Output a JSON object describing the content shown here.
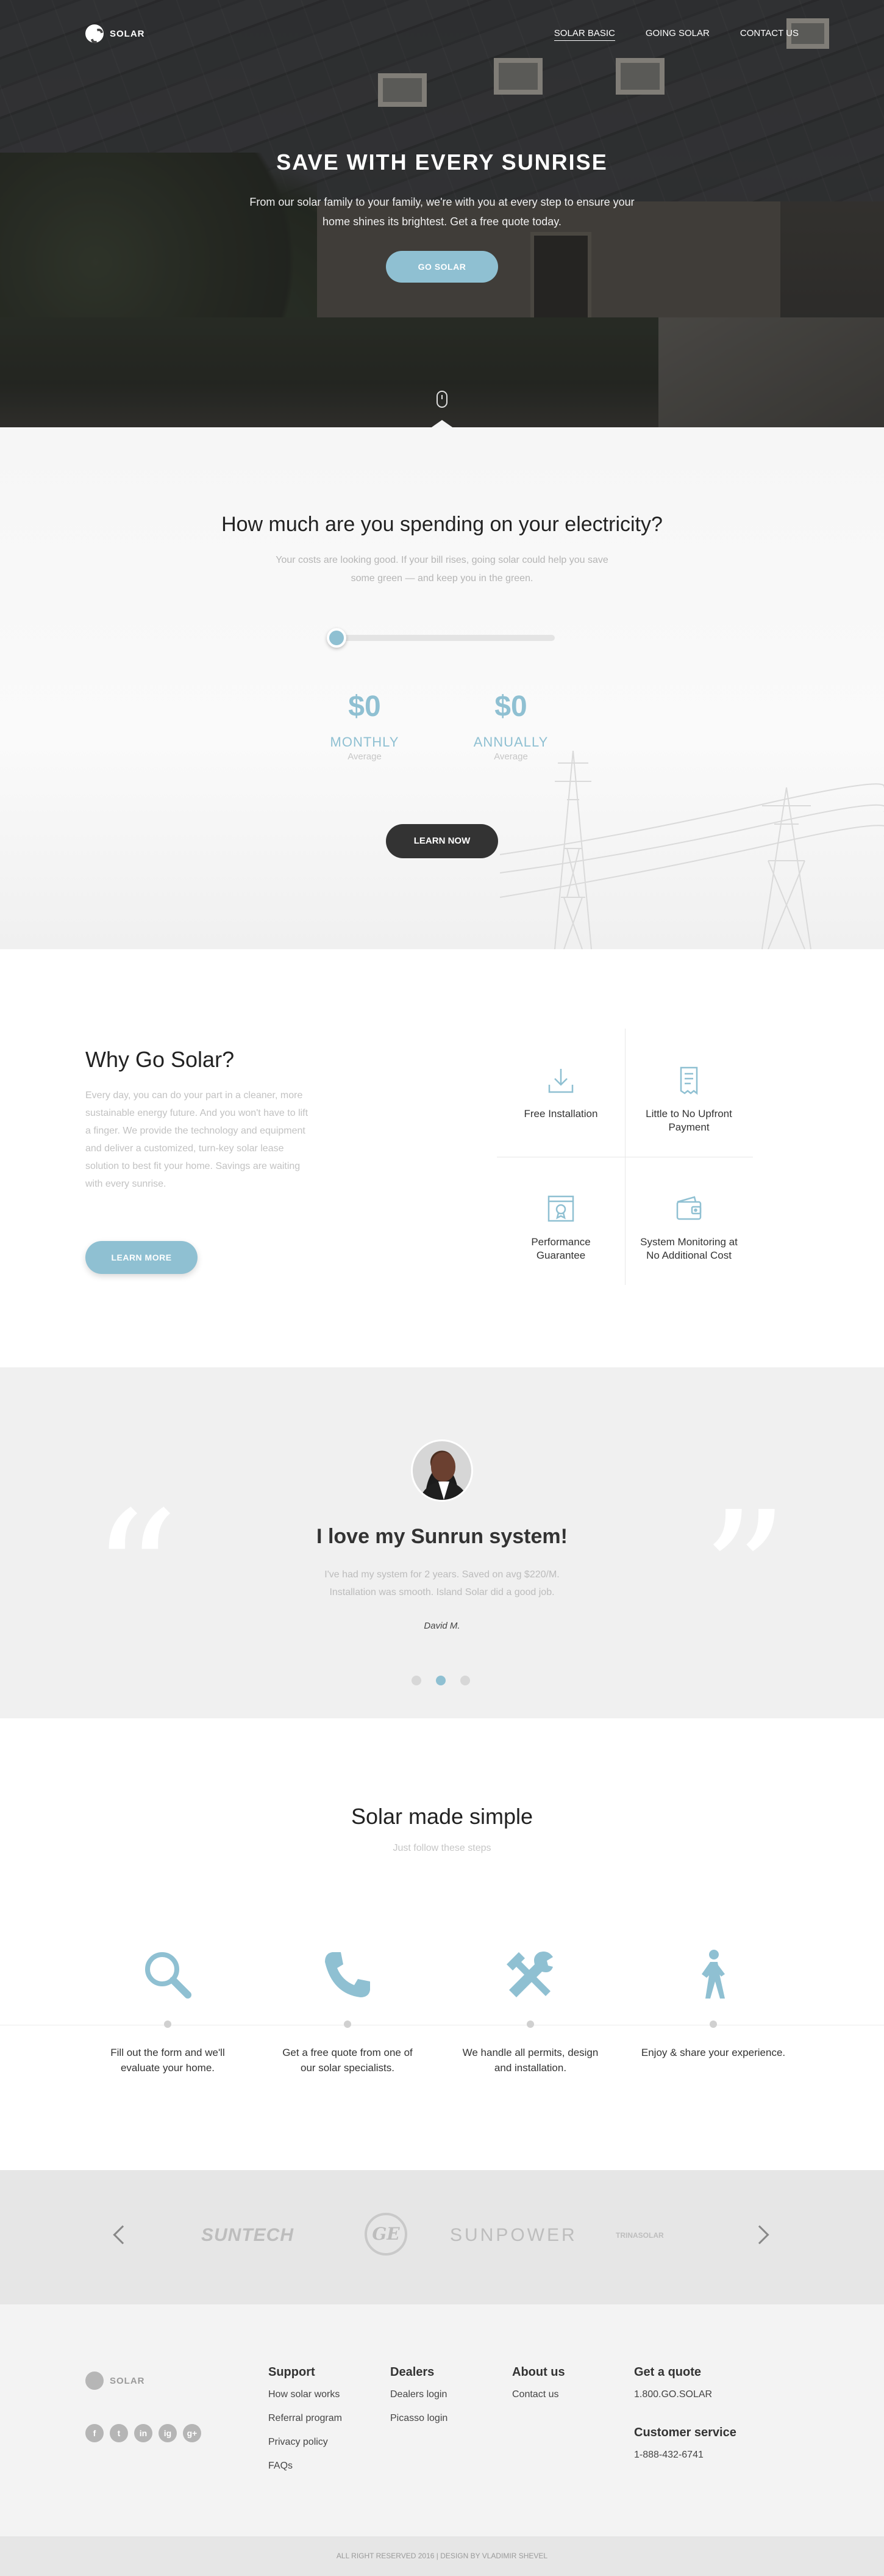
{
  "brand": {
    "name": "SOLAR"
  },
  "nav": {
    "items": [
      "SOLAR BASIC",
      "GOING SOLAR",
      "CONTACT US"
    ]
  },
  "hero": {
    "title": "SAVE WITH EVERY SUNRISE",
    "subtitle": "From our solar family to your family, we're with you at every step to ensure your home shines its brightest. Get a free quote today.",
    "cta": "GO SOLAR"
  },
  "spend": {
    "title": "How much are you spending on your electricity?",
    "subtitle": "Your costs are looking good. If your bill rises, going solar could help you save some green — and keep you in the green.",
    "slider_value": 0,
    "monthly": {
      "value": "$0",
      "label": "MONTHLY",
      "note": "Average"
    },
    "annually": {
      "value": "$0",
      "label": "ANNUALLY",
      "note": "Average"
    },
    "cta": "LEARN NOW"
  },
  "why": {
    "title": "Why Go Solar?",
    "body": "Every day, you can do your part in a cleaner, more sustainable energy future. And you won't have to lift a finger. We provide the technology and equipment and deliver a customized, turn-key solar lease solution to best fit your home. Savings are waiting with every sunrise.",
    "cta": "LEARN MORE",
    "features": [
      {
        "label": "Free Installation",
        "icon": "download-icon"
      },
      {
        "label": "Little to No Upfront Payment",
        "icon": "receipt-icon"
      },
      {
        "label": "Performance Guarantee",
        "icon": "certificate-icon"
      },
      {
        "label": "System Monitoring at No Additional Cost",
        "icon": "wallet-icon"
      }
    ]
  },
  "testimonial": {
    "title": "I love my Sunrun system!",
    "body": "I've had my system for 2 years. Saved on avg $220/M. Installation was smooth. Island Solar did a good job.",
    "author": "David M.",
    "active_dot": 1
  },
  "simple": {
    "title": "Solar made simple",
    "subtitle": "Just follow these steps",
    "steps": [
      {
        "label": "Fill out the form and we'll evaluate your home.",
        "icon": "magnifier-icon"
      },
      {
        "label": "Get a free quote from one of our solar specialists.",
        "icon": "phone-icon"
      },
      {
        "label": "We handle all permits, design and installation.",
        "icon": "tools-icon"
      },
      {
        "label": "Enjoy & share your experience.",
        "icon": "walking-person-icon"
      }
    ]
  },
  "partners": [
    "SUNTECH",
    "GE",
    "SUNPOWER",
    "TRINASOLAR"
  ],
  "footer": {
    "brand": "SOLAR",
    "social": [
      "f",
      "t",
      "in",
      "ig",
      "g+"
    ],
    "support": {
      "title": "Support",
      "links": [
        "How solar works",
        "Referral program",
        "Privacy policy",
        "FAQs"
      ]
    },
    "dealers": {
      "title": "Dealers",
      "links": [
        "Dealers login",
        "Picasso login"
      ]
    },
    "about": {
      "title": "About us",
      "links": [
        "Contact us"
      ]
    },
    "quote": {
      "title": "Get a quote",
      "phone": "1.800.GO.SOLAR"
    },
    "service": {
      "title": "Customer service",
      "phone": "1-888-432-6741"
    },
    "copyright": "ALL RIGHT RESERVED 2016 | DESIGN BY VLADIMIR SHEVEL"
  },
  "colors": {
    "accent": "#8fc0d2",
    "dark": "#333333"
  }
}
